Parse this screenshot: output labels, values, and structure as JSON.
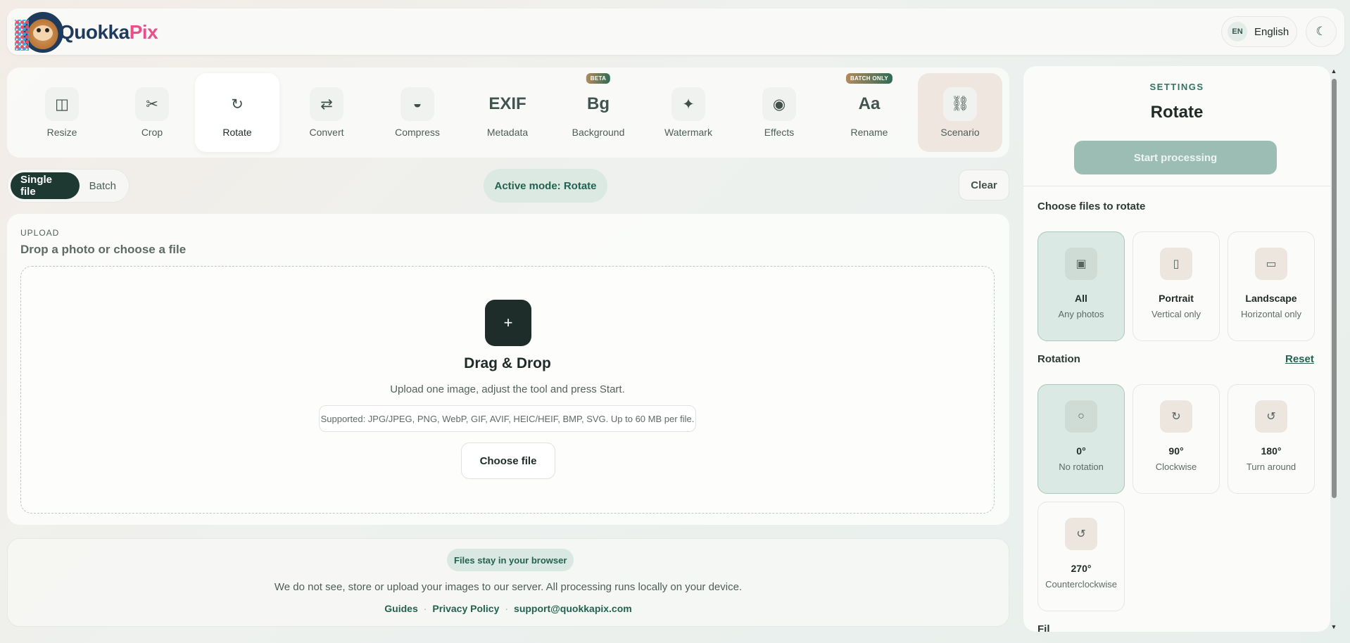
{
  "header": {
    "logo": {
      "q": "Q",
      "part1": "uokka",
      "part2": "Pix"
    },
    "lang_code": "EN",
    "lang_label": "English",
    "theme_icon": "moon-icon"
  },
  "tools": [
    {
      "label": "Resize",
      "icon": "◫",
      "icon_name": "resize-icon"
    },
    {
      "label": "Crop",
      "icon": "✂",
      "icon_name": "crop-icon"
    },
    {
      "label": "Rotate",
      "icon": "↻",
      "icon_name": "rotate-icon"
    },
    {
      "label": "Convert",
      "icon": "⇄",
      "icon_name": "convert-icon"
    },
    {
      "label": "Compress",
      "icon": "◒",
      "icon_name": "compress-icon"
    },
    {
      "label": "Metadata",
      "icon": "EXIF",
      "icon_name": "exif-icon"
    },
    {
      "label": "Background",
      "icon": "Bg",
      "icon_name": "background-icon",
      "badge": "BETA"
    },
    {
      "label": "Watermark",
      "icon": "✦",
      "icon_name": "watermark-icon"
    },
    {
      "label": "Effects",
      "icon": "◉",
      "icon_name": "effects-icon"
    },
    {
      "label": "Rename",
      "icon": "Aa",
      "icon_name": "rename-icon",
      "badge": "BATCH ONLY"
    },
    {
      "label": "Scenario",
      "icon": "⛓",
      "icon_name": "scenario-icon"
    }
  ],
  "mode": {
    "single": "Single file",
    "batch": "Batch",
    "active": "Active mode: Rotate",
    "clear": "Clear"
  },
  "upload": {
    "kicker": "UPLOAD",
    "title": "Drop a photo or choose a file",
    "plus": "+",
    "dz_title": "Drag & Drop",
    "dz_desc": "Upload one image, adjust the tool and press Start.",
    "formats": "Supported: JPG/JPEG, PNG, WebP, GIF, AVIF, HEIC/HEIF, BMP, SVG. Up to 60 MB per file.",
    "choose": "Choose file"
  },
  "privacy": {
    "badge": "Files stay in your browser",
    "text": "We do not see, store or upload your images to our server. All processing runs locally on your device.",
    "links": [
      "Guides",
      "Privacy Policy",
      "support@quokkapix.com"
    ],
    "sep": "·"
  },
  "settings": {
    "kicker": "SETTINGS",
    "title": "Rotate",
    "start": "Start processing",
    "files_title": "Choose files to rotate",
    "files": [
      {
        "name": "All",
        "sub": "Any photos",
        "icon": "▣",
        "icon_name": "all-photos-icon"
      },
      {
        "name": "Portrait",
        "sub": "Vertical only",
        "icon": "▯",
        "icon_name": "portrait-icon"
      },
      {
        "name": "Landscape",
        "sub": "Horizontal only",
        "icon": "▭",
        "icon_name": "landscape-icon"
      }
    ],
    "rotation_title": "Rotation",
    "reset": "Reset",
    "rotations": [
      {
        "name": "0°",
        "sub": "No rotation",
        "icon": "○",
        "icon_name": "no-rotation-icon"
      },
      {
        "name": "90°",
        "sub": "Clockwise",
        "icon": "↻",
        "icon_name": "rotate-cw-icon"
      },
      {
        "name": "180°",
        "sub": "Turn around",
        "icon": "↺",
        "icon_name": "turn-around-icon"
      },
      {
        "name": "270°",
        "sub": "Counterclockwise",
        "icon": "↺",
        "icon_name": "rotate-ccw-icon"
      }
    ],
    "next_section": "Fil"
  }
}
